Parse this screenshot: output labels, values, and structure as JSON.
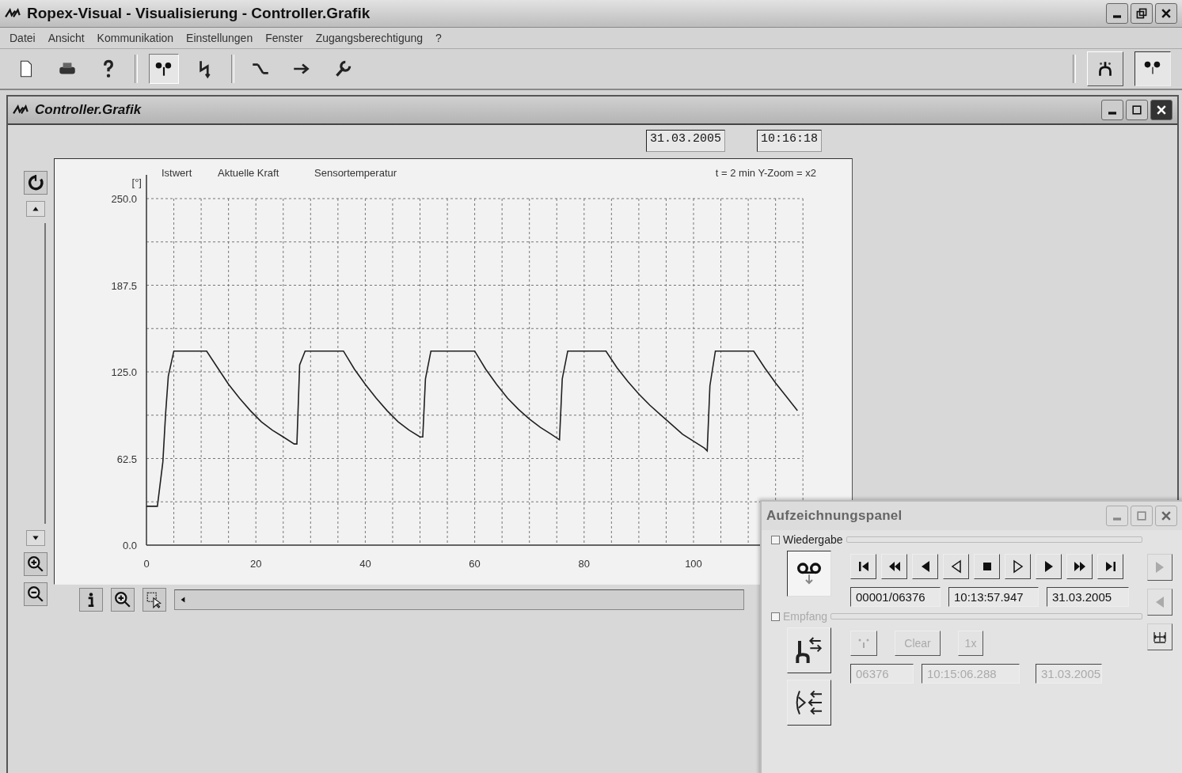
{
  "window": {
    "title": "Ropex-Visual - Visualisierung - Controller.Grafik"
  },
  "menu": [
    "Datei",
    "Ansicht",
    "Kommunikation",
    "Einstellungen",
    "Fenster",
    "Zugangsberechtigung",
    "?"
  ],
  "toolbar": [
    {
      "kind": "new",
      "pressed": false
    },
    {
      "kind": "print",
      "pressed": false
    },
    {
      "kind": "help",
      "pressed": false
    },
    {
      "kind": "graph",
      "pressed": true
    },
    {
      "kind": "bolt",
      "pressed": false
    },
    {
      "kind": "connect",
      "pressed": false
    },
    {
      "kind": "arrow",
      "pressed": false
    },
    {
      "kind": "wrench",
      "pressed": false
    }
  ],
  "toolbar_right": [
    {
      "kind": "robot",
      "pressed": false
    },
    {
      "kind": "tape",
      "pressed": true
    }
  ],
  "child_window": {
    "title": "Controller.Grafik",
    "date": "31.03.2005",
    "time": "10:16:18",
    "legend": [
      "Istwert",
      "Aktuelle Kraft",
      "Sensortemperatur"
    ],
    "info": "t = 2 min   Y-Zoom = x2",
    "unit": "[°]",
    "chart_data": {
      "type": "line",
      "grid": true,
      "xlim": [
        0,
        120
      ],
      "ylim": [
        0,
        250
      ],
      "xticks": [
        0,
        20,
        40,
        60,
        80,
        100
      ],
      "yticks": [
        {
          "value": 0,
          "label": "0.0"
        },
        {
          "value": 62.5,
          "label": "62.5"
        },
        {
          "value": 125,
          "label": "125.0"
        },
        {
          "value": 187.5,
          "label": "187.5"
        },
        {
          "value": 250,
          "label": "250.0"
        }
      ],
      "x": [
        0,
        2,
        3,
        3.5,
        4,
        5,
        11,
        13,
        15,
        17,
        19,
        21,
        23,
        25,
        27,
        27.5,
        28,
        29,
        36,
        38,
        40,
        42,
        44,
        46,
        48,
        50,
        50.5,
        51,
        52,
        60,
        62,
        64,
        66,
        68,
        70,
        72,
        74,
        75.5,
        76,
        77,
        84,
        86,
        88,
        90,
        92,
        94,
        96,
        98,
        100,
        102,
        102.5,
        103,
        104,
        111,
        113,
        115,
        117,
        119
      ],
      "series": [
        {
          "color": "#202020",
          "values": [
            28,
            28,
            60,
            95,
            122,
            140,
            140,
            128,
            116,
            106,
            97,
            89,
            83,
            78,
            73,
            73,
            130,
            140,
            140,
            127,
            116,
            106,
            97,
            89,
            83,
            78,
            78,
            120,
            140,
            140,
            127,
            116,
            106,
            98,
            91,
            85,
            80,
            76,
            120,
            140,
            140,
            128,
            118,
            109,
            101,
            94,
            87,
            80,
            75,
            70,
            68,
            115,
            140,
            140,
            128,
            117,
            107,
            97
          ]
        }
      ]
    }
  },
  "panel": {
    "title": "Aufzeichnungspanel",
    "playback": {
      "label": "Wiedergabe",
      "checked": false,
      "buttons": [
        {
          "kind": "first"
        },
        {
          "kind": "rewind"
        },
        {
          "kind": "step-back"
        },
        {
          "kind": "back"
        },
        {
          "kind": "stop"
        },
        {
          "kind": "play"
        },
        {
          "kind": "step-forward"
        },
        {
          "kind": "forward"
        },
        {
          "kind": "last"
        }
      ],
      "fields": [
        "00001/06376",
        "10:13:57.947",
        "31.03.2005"
      ]
    },
    "receive": {
      "label": "Empfang",
      "checked": false,
      "disabled": true,
      "buttons": [
        "Clear",
        "1x"
      ],
      "fields": [
        "06376",
        "10:15:06.288",
        "31.03.2005"
      ]
    }
  }
}
